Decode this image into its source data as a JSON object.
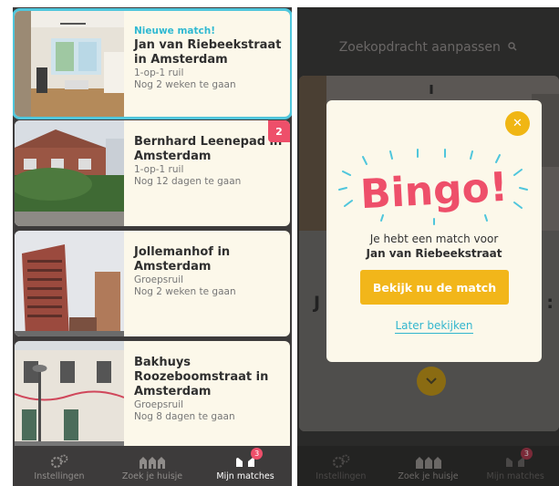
{
  "left_screen": {
    "cards": [
      {
        "new_label": "Nieuwe match!",
        "title": "Jan van Riebeekstraat in Amsterdam",
        "type": "1-op-1 ruil",
        "time_left": "Nog 2 weken te gaan",
        "badge": ""
      },
      {
        "new_label": "",
        "title": "Bernhard Leenepad in Amsterdam",
        "type": "1-op-1 ruil",
        "time_left": "Nog 12 dagen te gaan",
        "badge": "2"
      },
      {
        "new_label": "",
        "title": "Jollemanhof in Amsterdam",
        "type": "Groepsruil",
        "time_left": "Nog 2 weken te gaan",
        "badge": ""
      },
      {
        "new_label": "",
        "title": "Bakhuys Roozeboomstraat in Amsterdam",
        "type": "Groepsruil",
        "time_left": "Nog 8 dagen te gaan",
        "badge": ""
      }
    ],
    "tabs": [
      {
        "label": "Instellingen",
        "icon": "gears-icon"
      },
      {
        "label": "Zoek je huisje",
        "icon": "houses-icon"
      },
      {
        "label": "Mijn matches",
        "icon": "hands-icon",
        "badge": "3"
      }
    ]
  },
  "right_screen": {
    "header": "Zoekopdracht aanpassen",
    "background_left_char": "J",
    "background_right_char": ":",
    "modal": {
      "bingo_text": "Bingo!",
      "line1": "Je hebt een match voor",
      "line2": "Jan van Riebeekstraat",
      "primary_button": "Bekijk nu de match",
      "secondary_link": "Later bekijken"
    },
    "tabs": [
      {
        "label": "Instellingen"
      },
      {
        "label": "Zoek je huisje"
      },
      {
        "label": "Mijn matches",
        "badge": "3"
      }
    ]
  },
  "colors": {
    "accent_blue": "#4fc6dc",
    "bingo_pink": "#ee4f6a",
    "button_yellow": "#f2b61a",
    "card_cream": "#fcf8ea"
  }
}
